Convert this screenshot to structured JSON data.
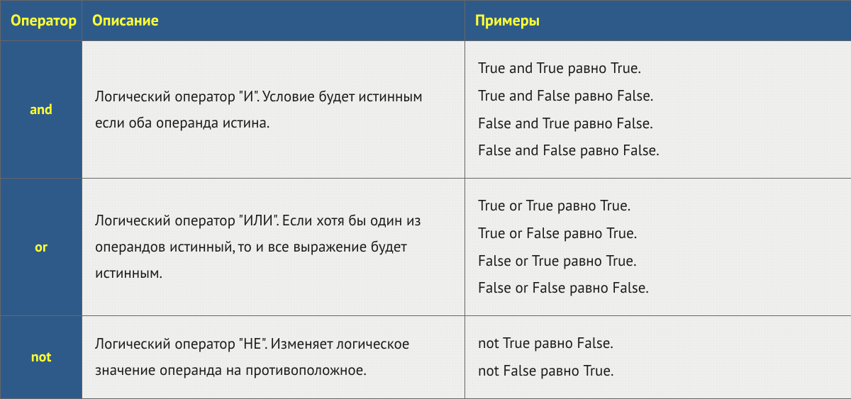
{
  "headers": {
    "operator": "Оператор",
    "description": "Описание",
    "examples": "Примеры"
  },
  "rows": [
    {
      "operator": "and",
      "description": "Логический оператор \"И\". Условие будет истинным если оба операнда истина.",
      "examples": [
        "True and True равно True.",
        "True and False равно False.",
        "False and True равно False.",
        "False and False равно False."
      ]
    },
    {
      "operator": "or",
      "description": "Логический оператор \"ИЛИ\". Если хотя бы один из операндов истинный, то и все выражение будет истинным.",
      "examples": [
        "True or True равно True.",
        "True or False равно True.",
        "False or True равно True.",
        "False or False равно False."
      ]
    },
    {
      "operator": "not",
      "description": "Логический оператор \"НЕ\". Изменяет логическое значение операнда на противоположное.",
      "examples": [
        "not True равно False.",
        "not False равно True."
      ]
    }
  ]
}
